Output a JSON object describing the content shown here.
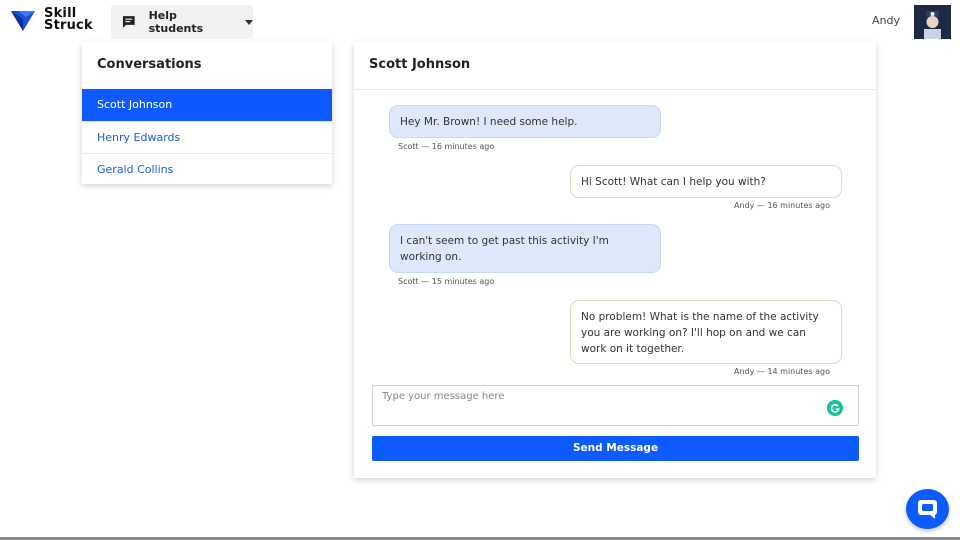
{
  "header": {
    "logo_line1": "Skill",
    "logo_line2": "Struck",
    "help_button_label": "Help students",
    "user_name": "Andy"
  },
  "conversations": {
    "title": "Conversations",
    "items": [
      {
        "name": "Scott Johnson",
        "active": true
      },
      {
        "name": "Henry Edwards",
        "active": false
      },
      {
        "name": "Gerald Collins",
        "active": false
      }
    ]
  },
  "chat": {
    "title": "Scott Johnson",
    "messages": [
      {
        "direction": "in",
        "text": "Hey Mr. Brown! I need some help.",
        "meta": "Scott — 16 minutes ago"
      },
      {
        "direction": "out",
        "text": "Hi Scott! What can I help you with?",
        "meta": "Andy — 16 minutes ago"
      },
      {
        "direction": "in",
        "text": "I can't seem to get past this activity I'm working on.",
        "meta": "Scott — 15 minutes ago"
      },
      {
        "direction": "out",
        "text": "No problem! What is the name of the activity you are working on? I'll hop on and we can work on it together.",
        "meta": "Andy — 14 minutes ago"
      }
    ],
    "input_placeholder": "Type your message here",
    "input_value": "",
    "send_label": "Send Message"
  },
  "colors": {
    "accent": "#0d5bff",
    "incoming_bubble": "#dfe8fb",
    "grammarly": "#15c39a"
  },
  "icons": {
    "logo": "skillstruck-logo-icon",
    "help": "chat-icon",
    "dropdown": "caret-down-icon",
    "grammarly": "grammarly-icon",
    "fab": "chat-bubble-icon"
  }
}
